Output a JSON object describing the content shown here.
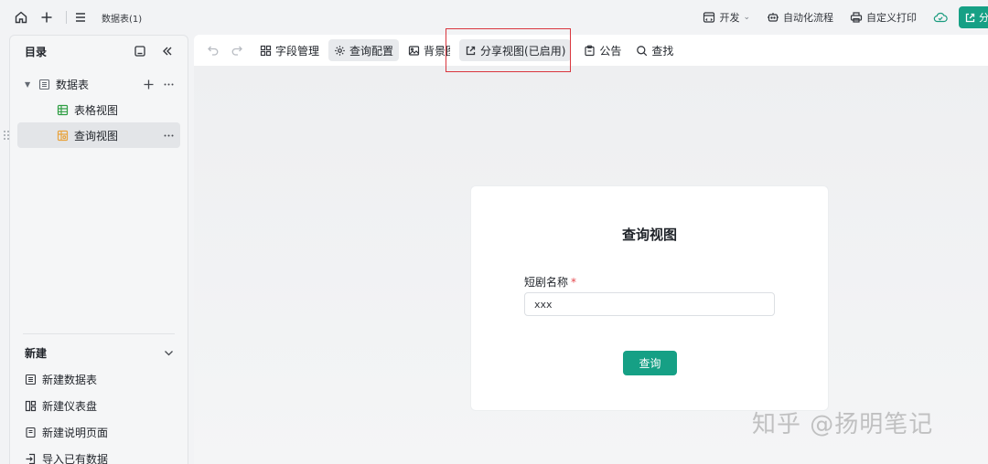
{
  "topbar": {
    "doc_title": "数据表(1)",
    "actions": {
      "develop": "开发",
      "automation": "自动化流程",
      "custom_print": "自定义打印",
      "share": "分"
    }
  },
  "sidebar": {
    "title": "目录",
    "tree": {
      "table": "数据表",
      "grid_view": "表格视图",
      "query_view": "查询视图"
    },
    "new_section": {
      "title": "新建",
      "items": [
        "新建数据表",
        "新建仪表盘",
        "新建说明页面",
        "导入已有数据"
      ]
    }
  },
  "toolbar": {
    "field_manage": "字段管理",
    "query_config": "查询配置",
    "background": "背景图",
    "share_view": "分享视图(已启用)",
    "notice": "公告",
    "search": "查找"
  },
  "card": {
    "title": "查询视图",
    "field_label": "短剧名称",
    "required_mark": "*",
    "field_value": "xxx",
    "submit_label": "查询"
  },
  "watermark": "知乎 @扬明笔记",
  "colors": {
    "accent": "#16a085",
    "highlight": "#d9363e",
    "required": "#e5484d"
  }
}
